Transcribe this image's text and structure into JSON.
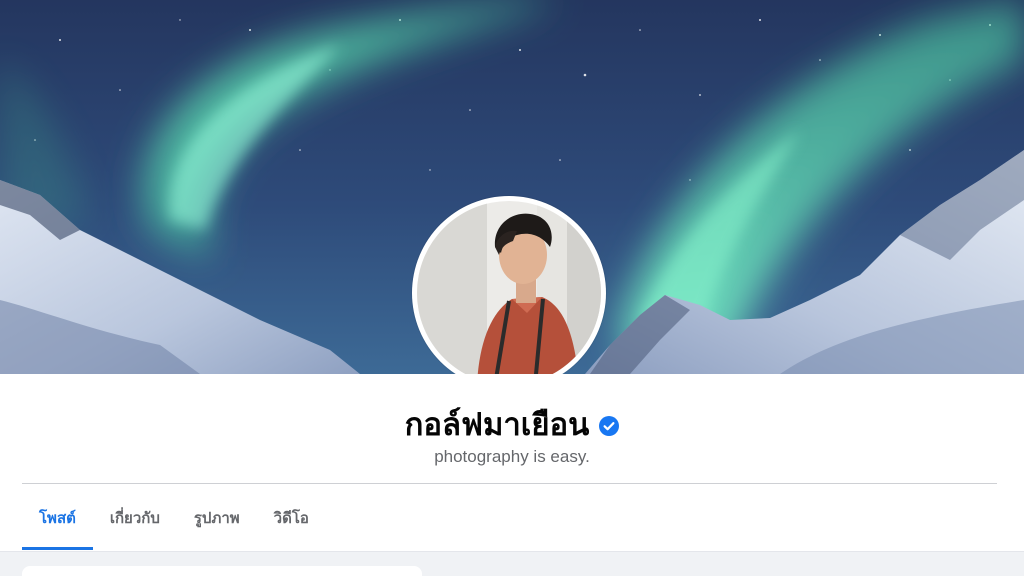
{
  "profile": {
    "name": "กอล์ฟมาเยือน",
    "bio": "photography is easy.",
    "verified": true
  },
  "tabs": [
    {
      "label": "โพสต์",
      "active": true
    },
    {
      "label": "เกี่ยวกับ",
      "active": false
    },
    {
      "label": "รูปภาพ",
      "active": false
    },
    {
      "label": "วิดีโอ",
      "active": false
    }
  ],
  "colors": {
    "accent": "#1b74e4",
    "verified": "#1877f2",
    "text_primary": "#050505",
    "text_secondary": "#65676b",
    "feed_background": "#f0f2f5"
  },
  "icons": {
    "verified": "verified-badge-icon"
  }
}
